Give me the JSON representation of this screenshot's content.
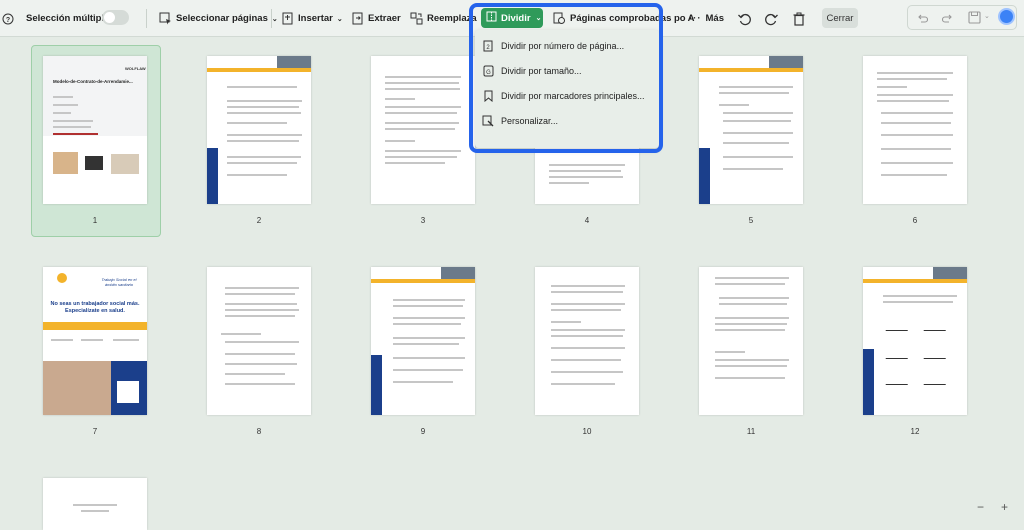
{
  "toolbar": {
    "multi_select_label": "Selección múltiple",
    "select_pages_label": "Seleccionar páginas",
    "insert_label": "Insertar",
    "extract_label": "Extraer",
    "replace_label": "Reemplaza",
    "split_label": "Dividir",
    "compare_label": "Páginas comprobadas po",
    "compare_suffix": "A",
    "more_label": "Más",
    "close_label": "Cerrar"
  },
  "split_menu": {
    "items": [
      {
        "label": "Dividir por número de página..."
      },
      {
        "label": "Dividir por tamaño..."
      },
      {
        "label": "Dividir por marcadores principales..."
      },
      {
        "label": "Personalizar..."
      }
    ]
  },
  "pages": [
    {
      "num": "1",
      "title": "Modelo-de-Contrato-de-Arrendamie..."
    },
    {
      "num": "2"
    },
    {
      "num": "3"
    },
    {
      "num": "4"
    },
    {
      "num": "5"
    },
    {
      "num": "6"
    },
    {
      "num": "7",
      "headline": "No seas un trabajador social más. Especialízate en salud.",
      "script_title": "Trabajo Social en el ámbito sanitario"
    },
    {
      "num": "8"
    },
    {
      "num": "9"
    },
    {
      "num": "10"
    },
    {
      "num": "11"
    },
    {
      "num": "12"
    }
  ],
  "colors": {
    "accent": "#2f9a5a",
    "highlight": "#2563eb",
    "brand_blue": "#1b3f8b",
    "brand_yellow": "#f3b32b"
  },
  "zoom_controls": {
    "minus": "−",
    "plus": "+"
  }
}
